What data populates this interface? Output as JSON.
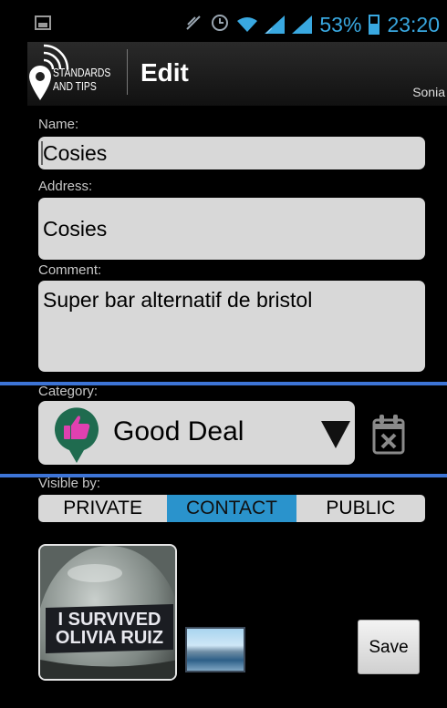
{
  "status_bar": {
    "battery_percent": "53%",
    "time": "23:20",
    "icons": [
      "image-notification-icon",
      "muted-icon",
      "alarm-icon",
      "wifi-icon",
      "signal-icon",
      "signal-icon",
      "battery-icon"
    ]
  },
  "action_bar": {
    "logo_line1": "STANDARDS",
    "logo_line2": "AND TIPS",
    "title": "Edit",
    "user": "Sonia"
  },
  "form": {
    "name_label": "Name:",
    "name_value": "Cosies",
    "address_label": "Address:",
    "address_value": "Cosies",
    "comment_label": "Comment:",
    "comment_value": "Super bar alternatif de bristol",
    "category_label": "Category:",
    "category_value": "Good Deal",
    "visible_label": "Visible by:",
    "visibility_options": [
      "PRIVATE",
      "CONTACT",
      "PUBLIC"
    ],
    "visibility_selected": "CONTACT"
  },
  "photo": {
    "caption_line1": "I SURVIVED",
    "caption_line2": "OLIVIA RUIZ"
  },
  "save_label": "Save",
  "colors": {
    "accent": "#2a93cc",
    "highlight_line": "#3d74d6",
    "field_bg": "#d8d8d8",
    "category_pin": "#1f6b4f",
    "thumb_icon": "#e040b0"
  }
}
